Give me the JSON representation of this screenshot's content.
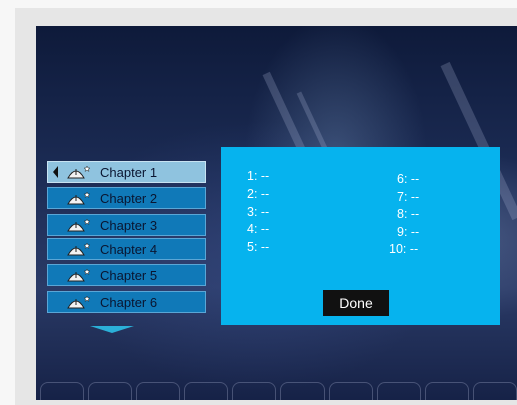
{
  "chapters": {
    "items": [
      {
        "label": "Chapter 1",
        "selected": true
      },
      {
        "label": "Chapter 2",
        "selected": false
      },
      {
        "label": "Chapter 3",
        "selected": false
      },
      {
        "label": "Chapter 4",
        "selected": false
      },
      {
        "label": "Chapter 5",
        "selected": false
      },
      {
        "label": "Chapter 6",
        "selected": false
      }
    ],
    "icon": "dome-sparkle-icon",
    "scroll_icon": "scroll-down-arrow-icon"
  },
  "playlist": {
    "slots": [
      "1: --",
      "2: --",
      "3: --",
      "4: --",
      "5: --",
      "6: --",
      "7: --",
      "8: --",
      "9: --",
      "10: --"
    ],
    "done_label": "Done"
  },
  "colors": {
    "panel": "#06b3ee",
    "chapter_item": "#1079b8",
    "chapter_selected": "#8fc3df",
    "done_button": "#111111",
    "background_dark": "#0e1a3a"
  }
}
